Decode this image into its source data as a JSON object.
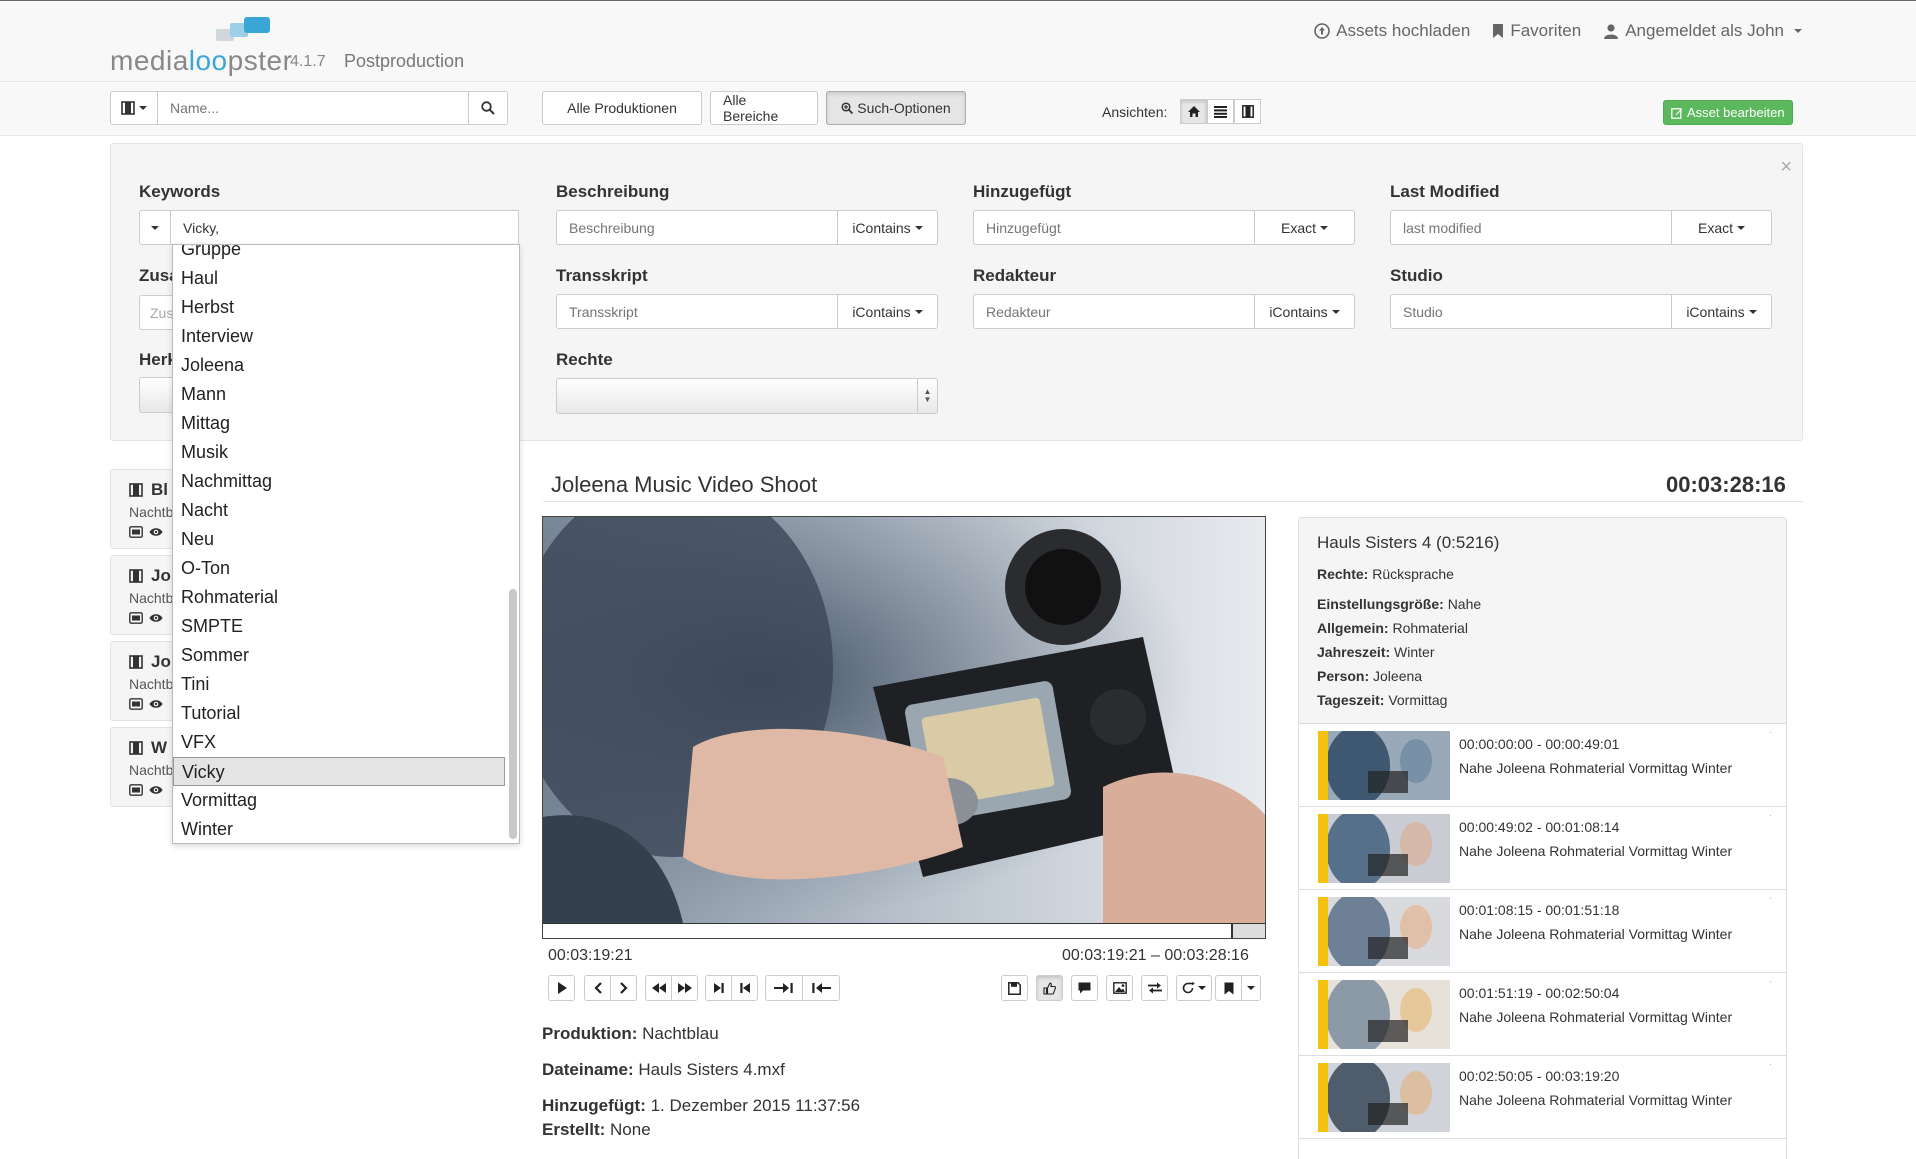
{
  "app": {
    "logo_left": "media",
    "logo_accent": "loo",
    "logo_right": "pster",
    "version": "4.1.7",
    "section": "Postproduction"
  },
  "topnav": {
    "upload": "Assets hochladen",
    "favorites": "Favoriten",
    "user": "Angemeldet als John"
  },
  "toolbar": {
    "search_placeholder": "Name...",
    "all_productions": "Alle Produktionen",
    "all_areas": "Alle Bereiche",
    "search_options": "Such-Optionen",
    "views_label": "Ansichten:",
    "edit_asset": "Asset bearbeiten"
  },
  "search_options": {
    "close": "×",
    "keywords": {
      "label": "Keywords",
      "value": "Vicky,"
    },
    "beschreibung": {
      "label": "Beschreibung",
      "placeholder": "Beschreibung",
      "mode": "iContains"
    },
    "hinzugefuegt": {
      "label": "Hinzugefügt",
      "placeholder": "Hinzugefügt",
      "mode": "Exact"
    },
    "last_modified": {
      "label": "Last Modified",
      "placeholder": "last modified",
      "mode": "Exact"
    },
    "transskript": {
      "label": "Transskript",
      "placeholder": "Transskript",
      "mode": "iContains"
    },
    "redakteur": {
      "label": "Redakteur",
      "placeholder": "Redakteur",
      "mode": "iContains"
    },
    "studio": {
      "label": "Studio",
      "placeholder": "Studio",
      "mode": "iContains"
    },
    "rechte": {
      "label": "Rechte"
    },
    "partial_labels": [
      "Zusa",
      "Zus",
      "Herk"
    ]
  },
  "keyword_list": [
    "Gruppe",
    "Haul",
    "Herbst",
    "Interview",
    "Joleena",
    "Mann",
    "Mittag",
    "Musik",
    "Nachmittag",
    "Nacht",
    "Neu",
    "O-Ton",
    "Rohmaterial",
    "SMPTE",
    "Sommer",
    "Tini",
    "Tutorial",
    "VFX",
    "Vicky",
    "Vormittag",
    "Winter"
  ],
  "keyword_selected": "Vicky",
  "asset_list": [
    {
      "title": "Bl",
      "sub": "Nachtb"
    },
    {
      "title": "Jo",
      "sub": "Nachtb"
    },
    {
      "title": "Jo",
      "sub": "Nachtb"
    },
    {
      "title": "W",
      "sub": "Nachtb"
    }
  ],
  "asset": {
    "title": "Joleena Music Video Shoot",
    "duration": "00:03:28:16",
    "tc_current": "00:03:19:21",
    "tc_range": "00:03:19:21 – 00:03:28:16",
    "produktion_label": "Produktion:",
    "produktion": "Nachtblau",
    "dateiname_label": "Dateiname:",
    "dateiname": "Hauls Sisters 4.mxf",
    "hinzugefuegt_label": "Hinzugefügt:",
    "hinzugefuegt": "1. Dezember 2015 11:37:56",
    "erstellt_label": "Erstellt:",
    "erstellt": "None"
  },
  "right_panel": {
    "title": "Hauls Sisters 4 (0:5216)",
    "rows": [
      {
        "k": "Rechte:",
        "v": "Rücksprache"
      },
      {
        "k": "Einstellungsgröße:",
        "v": "Nahe"
      },
      {
        "k": "Allgemein:",
        "v": "Rohmaterial"
      },
      {
        "k": "Jahreszeit:",
        "v": "Winter"
      },
      {
        "k": "Person:",
        "v": "Joleena"
      },
      {
        "k": "Tageszeit:",
        "v": "Vormittag"
      }
    ],
    "segments": [
      {
        "time": "00:00:00:00 - 00:00:49:01",
        "keywords": "Nahe Joleena Rohmaterial Vormittag Winter"
      },
      {
        "time": "00:00:49:02 - 00:01:08:14",
        "keywords": "Nahe Joleena Rohmaterial Vormittag Winter"
      },
      {
        "time": "00:01:08:15 - 00:01:51:18",
        "keywords": "Nahe Joleena Rohmaterial Vormittag Winter"
      },
      {
        "time": "00:01:51:19 - 00:02:50:04",
        "keywords": "Nahe Joleena Rohmaterial Vormittag Winter"
      },
      {
        "time": "00:02:50:05 - 00:03:19:20",
        "keywords": "Nahe Joleena Rohmaterial Vormittag Winter"
      }
    ]
  },
  "colors": {
    "accent": "#3aa6d8",
    "success": "#5cb85c",
    "segment_bar": "#f4c20d"
  }
}
